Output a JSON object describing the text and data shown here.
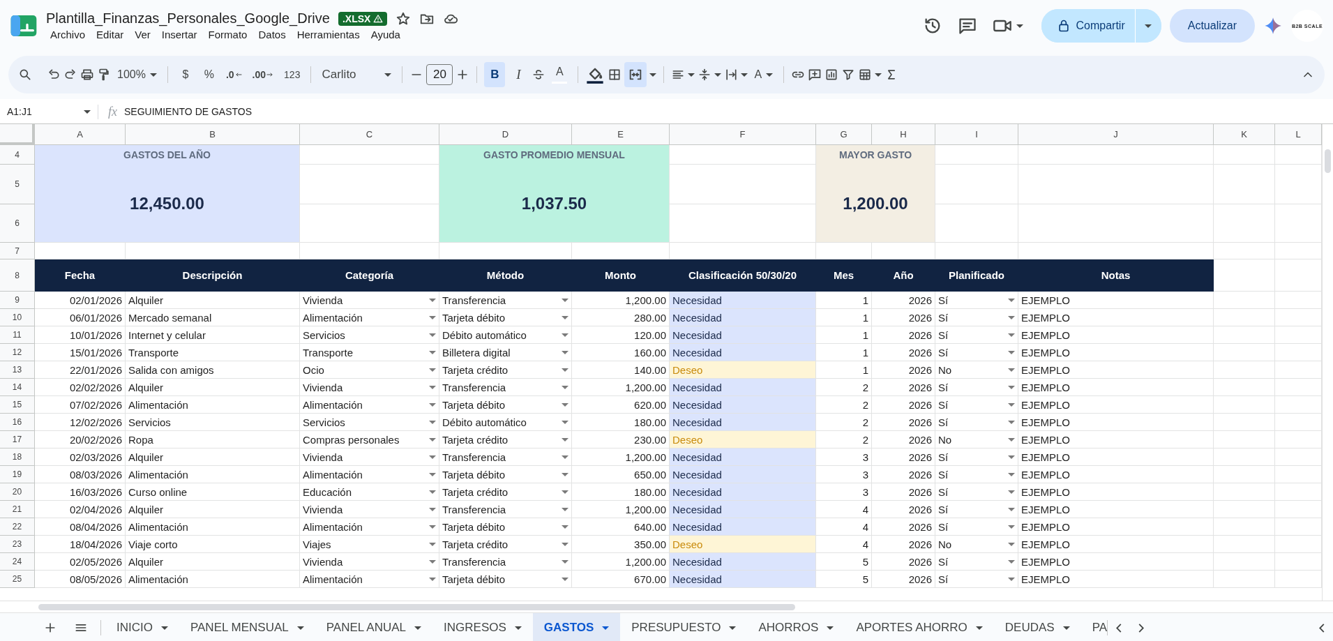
{
  "document": {
    "title": "Plantilla_Finanzas_Personales_Google_Drive",
    "badge": ".XLSX"
  },
  "menu": [
    "Archivo",
    "Editar",
    "Ver",
    "Insertar",
    "Formato",
    "Datos",
    "Herramientas",
    "Ayuda"
  ],
  "header_actions": {
    "share": "Compartir",
    "update": "Actualizar",
    "avatar": "B2B SCALE"
  },
  "toolbar": {
    "zoom": "100%",
    "currency": "$",
    "percent": "%",
    "decrease_decimals": ".0",
    "increase_decimals": ".00",
    "number_format": "123",
    "font": "Carlito",
    "font_size": "20",
    "bold": {
      "label": "B",
      "on": true
    },
    "italic": {
      "label": "I",
      "on": false
    },
    "text_color": {
      "label": "A",
      "on": false
    },
    "merge": {
      "on": true
    },
    "text_rotation": "A"
  },
  "formula_bar": {
    "range": "A1:J1",
    "fx": "fx",
    "content": "SEGUIMIENTO DE GASTOS"
  },
  "columns": [
    "A",
    "B",
    "C",
    "D",
    "E",
    "F",
    "G",
    "H",
    "I",
    "J",
    "K",
    "L"
  ],
  "summary": [
    {
      "label": "GASTOS DEL AÑO",
      "value": "12,450.00",
      "color": "#dbe4fd"
    },
    {
      "label": "GASTO PROMEDIO MENSUAL",
      "value": "1,037.50",
      "color": "#bbf2e0"
    },
    {
      "label": "MAYOR GASTO",
      "value": "1,200.00",
      "color": "#f3eee3"
    }
  ],
  "summary_rows": [
    "4",
    "5",
    "6",
    "7"
  ],
  "table": {
    "header_row": "8",
    "columns": [
      "Fecha",
      "Descripción",
      "Categoría",
      "Método",
      "Monto",
      "Clasificación 50/30/20",
      "Mes",
      "Año",
      "Planificado",
      "Notas"
    ],
    "rows": [
      {
        "row": "9",
        "fecha": "02/01/2026",
        "descripcion": "Alquiler",
        "categoria": "Vivienda",
        "metodo": "Transferencia",
        "monto": "1,200.00",
        "clasificacion": {
          "text": "Necesidad",
          "kind": "need"
        },
        "mes": "1",
        "anio": "2026",
        "planificado": "Sí",
        "notas": "EJEMPLO"
      },
      {
        "row": "10",
        "fecha": "06/01/2026",
        "descripcion": "Mercado semanal",
        "categoria": "Alimentación",
        "metodo": "Tarjeta débito",
        "monto": "280.00",
        "clasificacion": {
          "text": "Necesidad",
          "kind": "need"
        },
        "mes": "1",
        "anio": "2026",
        "planificado": "Sí",
        "notas": "EJEMPLO"
      },
      {
        "row": "11",
        "fecha": "10/01/2026",
        "descripcion": "Internet y celular",
        "categoria": "Servicios",
        "metodo": "Débito automático",
        "monto": "120.00",
        "clasificacion": {
          "text": "Necesidad",
          "kind": "need"
        },
        "mes": "1",
        "anio": "2026",
        "planificado": "Sí",
        "notas": "EJEMPLO"
      },
      {
        "row": "12",
        "fecha": "15/01/2026",
        "descripcion": "Transporte",
        "categoria": "Transporte",
        "metodo": "Billetera digital",
        "monto": "160.00",
        "clasificacion": {
          "text": "Necesidad",
          "kind": "need"
        },
        "mes": "1",
        "anio": "2026",
        "planificado": "Sí",
        "notas": "EJEMPLO"
      },
      {
        "row": "13",
        "fecha": "22/01/2026",
        "descripcion": "Salida con amigos",
        "categoria": "Ocio",
        "metodo": "Tarjeta crédito",
        "monto": "140.00",
        "clasificacion": {
          "text": "Deseo",
          "kind": "want"
        },
        "mes": "1",
        "anio": "2026",
        "planificado": "No",
        "notas": "EJEMPLO"
      },
      {
        "row": "14",
        "fecha": "02/02/2026",
        "descripcion": "Alquiler",
        "categoria": "Vivienda",
        "metodo": "Transferencia",
        "monto": "1,200.00",
        "clasificacion": {
          "text": "Necesidad",
          "kind": "need"
        },
        "mes": "2",
        "anio": "2026",
        "planificado": "Sí",
        "notas": "EJEMPLO"
      },
      {
        "row": "15",
        "fecha": "07/02/2026",
        "descripcion": "Alimentación",
        "categoria": "Alimentación",
        "metodo": "Tarjeta débito",
        "monto": "620.00",
        "clasificacion": {
          "text": "Necesidad",
          "kind": "need"
        },
        "mes": "2",
        "anio": "2026",
        "planificado": "Sí",
        "notas": "EJEMPLO"
      },
      {
        "row": "16",
        "fecha": "12/02/2026",
        "descripcion": "Servicios",
        "categoria": "Servicios",
        "metodo": "Débito automático",
        "monto": "180.00",
        "clasificacion": {
          "text": "Necesidad",
          "kind": "need"
        },
        "mes": "2",
        "anio": "2026",
        "planificado": "Sí",
        "notas": "EJEMPLO"
      },
      {
        "row": "17",
        "fecha": "20/02/2026",
        "descripcion": "Ropa",
        "categoria": "Compras personales",
        "metodo": "Tarjeta crédito",
        "monto": "230.00",
        "clasificacion": {
          "text": "Deseo",
          "kind": "want"
        },
        "mes": "2",
        "anio": "2026",
        "planificado": "No",
        "notas": "EJEMPLO"
      },
      {
        "row": "18",
        "fecha": "02/03/2026",
        "descripcion": "Alquiler",
        "categoria": "Vivienda",
        "metodo": "Transferencia",
        "monto": "1,200.00",
        "clasificacion": {
          "text": "Necesidad",
          "kind": "need"
        },
        "mes": "3",
        "anio": "2026",
        "planificado": "Sí",
        "notas": "EJEMPLO"
      },
      {
        "row": "19",
        "fecha": "08/03/2026",
        "descripcion": "Alimentación",
        "categoria": "Alimentación",
        "metodo": "Tarjeta débito",
        "monto": "650.00",
        "clasificacion": {
          "text": "Necesidad",
          "kind": "need"
        },
        "mes": "3",
        "anio": "2026",
        "planificado": "Sí",
        "notas": "EJEMPLO"
      },
      {
        "row": "20",
        "fecha": "16/03/2026",
        "descripcion": "Curso online",
        "categoria": "Educación",
        "metodo": "Tarjeta crédito",
        "monto": "180.00",
        "clasificacion": {
          "text": "Necesidad",
          "kind": "need"
        },
        "mes": "3",
        "anio": "2026",
        "planificado": "Sí",
        "notas": "EJEMPLO"
      },
      {
        "row": "21",
        "fecha": "02/04/2026",
        "descripcion": "Alquiler",
        "categoria": "Vivienda",
        "metodo": "Transferencia",
        "monto": "1,200.00",
        "clasificacion": {
          "text": "Necesidad",
          "kind": "need"
        },
        "mes": "4",
        "anio": "2026",
        "planificado": "Sí",
        "notas": "EJEMPLO"
      },
      {
        "row": "22",
        "fecha": "08/04/2026",
        "descripcion": "Alimentación",
        "categoria": "Alimentación",
        "metodo": "Tarjeta débito",
        "monto": "640.00",
        "clasificacion": {
          "text": "Necesidad",
          "kind": "need"
        },
        "mes": "4",
        "anio": "2026",
        "planificado": "Sí",
        "notas": "EJEMPLO"
      },
      {
        "row": "23",
        "fecha": "18/04/2026",
        "descripcion": "Viaje corto",
        "categoria": "Viajes",
        "metodo": "Tarjeta crédito",
        "monto": "350.00",
        "clasificacion": {
          "text": "Deseo",
          "kind": "want"
        },
        "mes": "4",
        "anio": "2026",
        "planificado": "No",
        "notas": "EJEMPLO"
      },
      {
        "row": "24",
        "fecha": "02/05/2026",
        "descripcion": "Alquiler",
        "categoria": "Vivienda",
        "metodo": "Transferencia",
        "monto": "1,200.00",
        "clasificacion": {
          "text": "Necesidad",
          "kind": "need"
        },
        "mes": "5",
        "anio": "2026",
        "planificado": "Sí",
        "notas": "EJEMPLO"
      },
      {
        "row": "25",
        "fecha": "08/05/2026",
        "descripcion": "Alimentación",
        "categoria": "Alimentación",
        "metodo": "Tarjeta débito",
        "monto": "670.00",
        "clasificacion": {
          "text": "Necesidad",
          "kind": "need"
        },
        "mes": "5",
        "anio": "2026",
        "planificado": "Sí",
        "notas": "EJEMPLO"
      }
    ]
  },
  "sheet_tabs": [
    {
      "label": "INICIO",
      "selected": false,
      "cut": false
    },
    {
      "label": "PANEL MENSUAL",
      "selected": false,
      "cut": false
    },
    {
      "label": "PANEL ANUAL",
      "selected": false,
      "cut": false
    },
    {
      "label": "INGRESOS",
      "selected": false,
      "cut": false
    },
    {
      "label": "GASTOS",
      "selected": true,
      "cut": false
    },
    {
      "label": "PRESUPUESTO",
      "selected": false,
      "cut": false
    },
    {
      "label": "AHORROS",
      "selected": false,
      "cut": false
    },
    {
      "label": "APORTES AHORRO",
      "selected": false,
      "cut": false
    },
    {
      "label": "DEUDAS",
      "selected": false,
      "cut": false
    },
    {
      "label": "PA",
      "selected": false,
      "cut": true
    }
  ]
}
